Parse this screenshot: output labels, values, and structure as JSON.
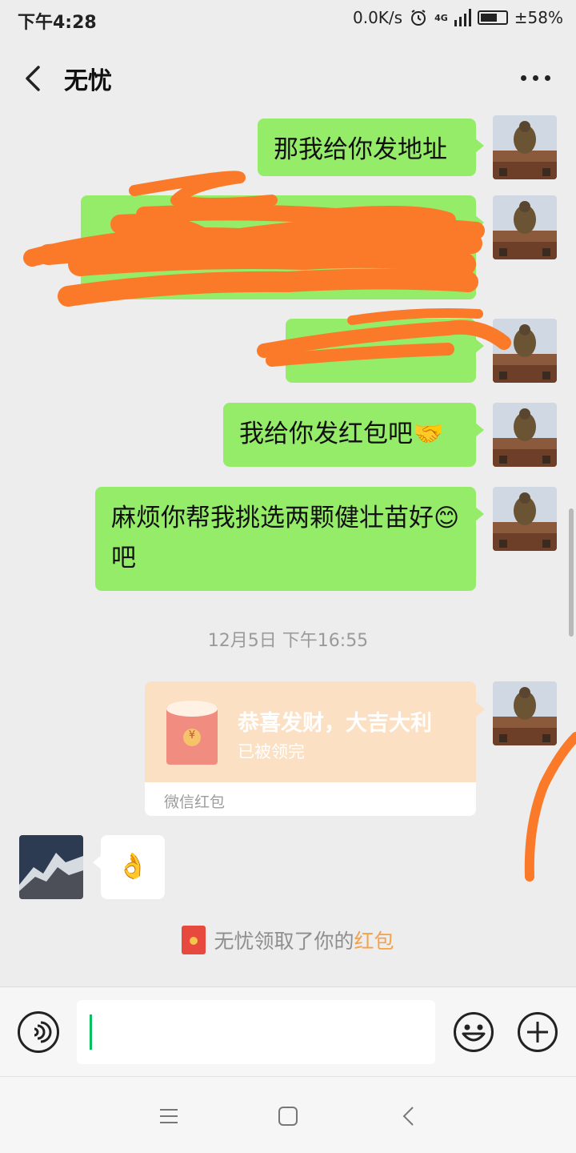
{
  "status_bar": {
    "time": "下午4:28",
    "network_speed": "0.0K/s",
    "network_type": "4G",
    "battery": "±58%"
  },
  "header": {
    "title": "无忧",
    "back_icon": "chevron-left-icon",
    "more_icon": "more-dots-icon"
  },
  "messages": [
    {
      "side": "right",
      "text": "那我给你发地址"
    },
    {
      "side": "right",
      "text": "",
      "redacted": true
    },
    {
      "side": "right",
      "text": "",
      "redacted": true
    },
    {
      "side": "right",
      "text": "我给你发红包吧🤝"
    },
    {
      "side": "right",
      "text": "麻烦你帮我挑选两颗健壮苗好😊 吧"
    }
  ],
  "timestamp": "12月5日 下午16:55",
  "red_packet": {
    "title": "恭喜发财，大吉大利",
    "status": "已被领完",
    "footer": "微信红包",
    "currency_symbol": "¥"
  },
  "reply": {
    "side": "left",
    "text": "👌"
  },
  "system_message": {
    "prefix": "无忧领取了你的",
    "highlight": "红包"
  },
  "input": {
    "value": "",
    "voice_icon": "voice-icon",
    "emoji_icon": "emoji-icon",
    "plus_icon": "plus-icon"
  },
  "system_nav": {
    "menu_icon": "menu-icon",
    "home_icon": "home-icon",
    "back_icon": "back-icon"
  },
  "colors": {
    "bubble_green": "#95ec69",
    "background": "#ededed",
    "red_packet": "#fbe0c4",
    "scribble": "#fb7a2a",
    "accent": "#07c160"
  }
}
